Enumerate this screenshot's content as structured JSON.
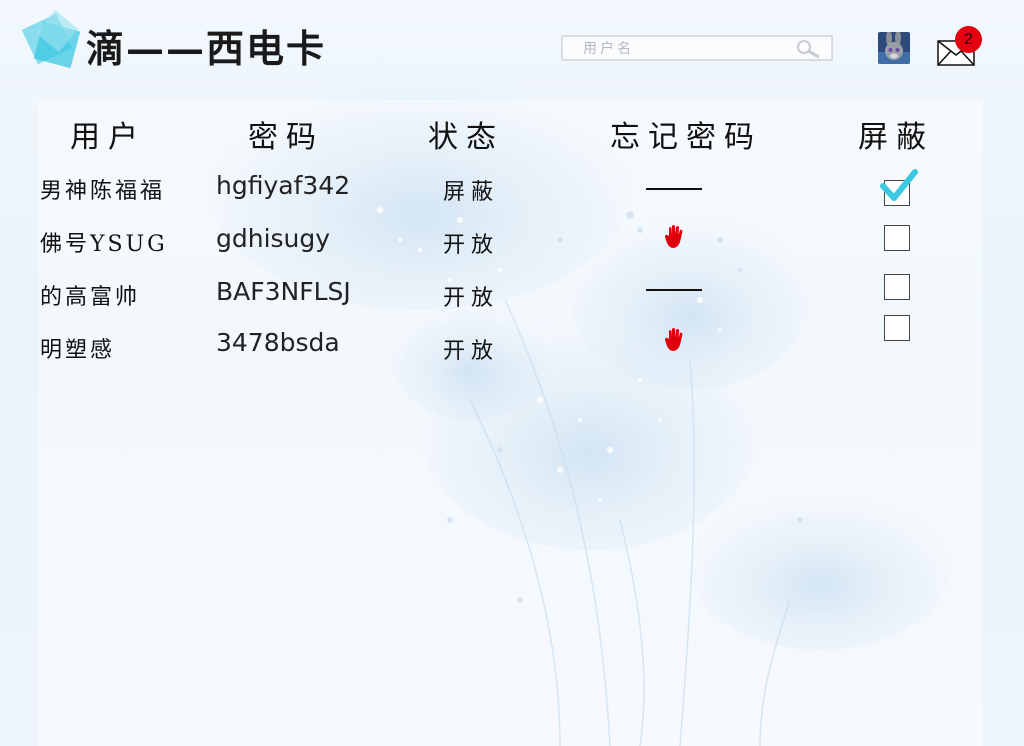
{
  "app": {
    "title": "滴——西电卡"
  },
  "search": {
    "placeholder": "用户名"
  },
  "notifications": {
    "count": "2"
  },
  "table": {
    "headers": [
      "用户",
      "密码",
      "状态",
      "忘记密码",
      "屏蔽"
    ],
    "rows": [
      {
        "user": "男神陈福福",
        "password": "hgfiyaf342",
        "status": "屏蔽",
        "forgot": "dash",
        "blocked": true
      },
      {
        "user": "佛号YSUG",
        "password": "gdhisugy",
        "status": "开放",
        "forgot": "hand-icon",
        "blocked": false
      },
      {
        "user": "的高富帅",
        "password": "BAF3NFLSJ",
        "status": "开放",
        "forgot": "dash",
        "blocked": false
      },
      {
        "user": "明塑感",
        "password": "3478bsda",
        "status": "开放",
        "forgot": "hand-icon",
        "blocked": false
      }
    ]
  },
  "colors": {
    "accent": "#3cc8e0",
    "badge": "#e4000f",
    "hand": "#e0000c"
  }
}
